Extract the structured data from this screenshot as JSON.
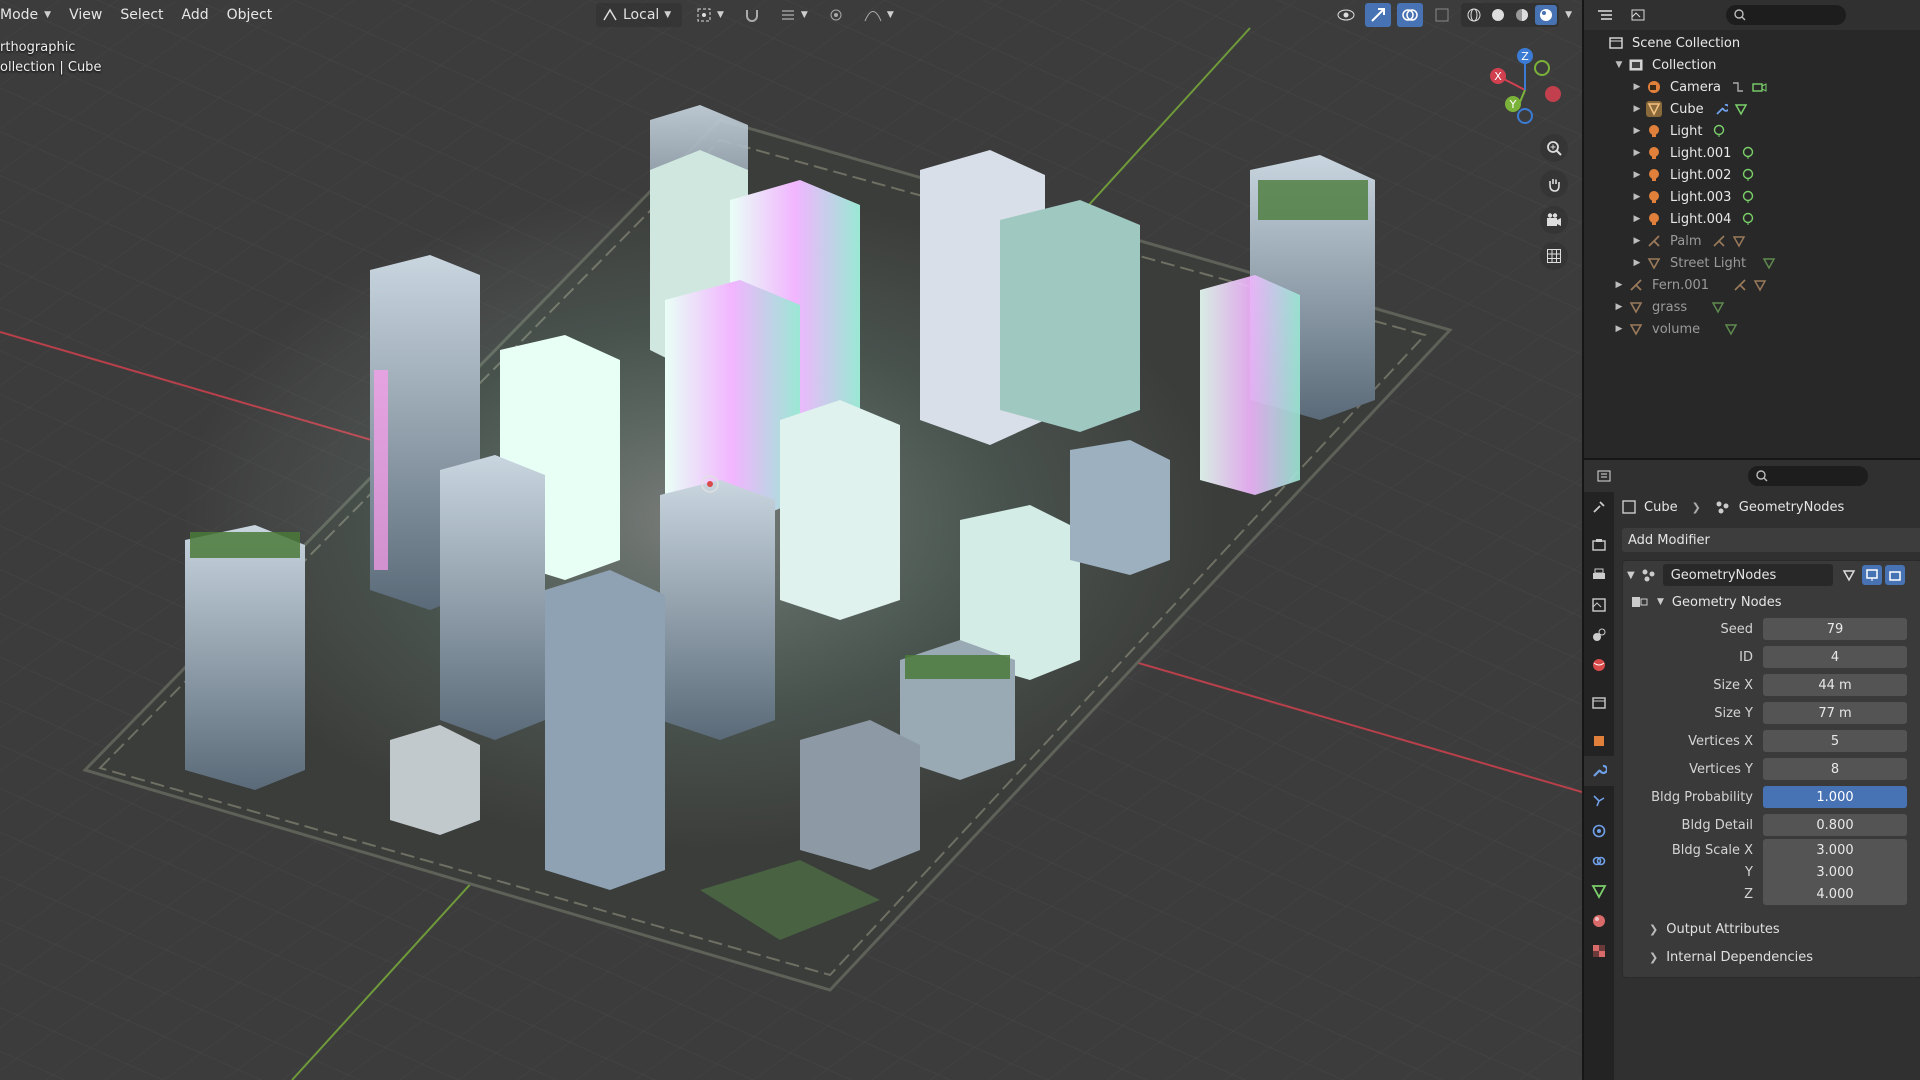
{
  "viewport": {
    "menu": {
      "mode": "Mode",
      "view": "View",
      "select": "Select",
      "add": "Add",
      "object": "Object"
    },
    "transform_orientation": "Local",
    "info_line1": "rthographic",
    "info_line2": "ollection | Cube",
    "gizmo_axes": {
      "x": "X",
      "y": "Y",
      "z": "Z"
    },
    "colors": {
      "x_axis": "#d0404f",
      "y_axis": "#7bb33a",
      "z_axis": "#3b7bd4",
      "accent": "#4772b3"
    }
  },
  "outliner": {
    "search_placeholder": "",
    "items": [
      {
        "label": "Scene Collection"
      },
      {
        "label": "Collection"
      },
      {
        "label": "Camera"
      },
      {
        "label": "Cube"
      },
      {
        "label": "Light"
      },
      {
        "label": "Light.001"
      },
      {
        "label": "Light.002"
      },
      {
        "label": "Light.003"
      },
      {
        "label": "Light.004"
      },
      {
        "label": "Palm"
      },
      {
        "label": "Street Light"
      },
      {
        "label": "Fern.001"
      },
      {
        "label": "grass"
      },
      {
        "label": "volume"
      }
    ]
  },
  "properties": {
    "search_placeholder": "",
    "breadcrumb": {
      "object": "Cube",
      "modifier": "GeometryNodes"
    },
    "add_modifier": "Add Modifier",
    "modifier_name": "GeometryNodes",
    "node_group": "Geometry Nodes",
    "fields": [
      {
        "label": "Seed",
        "value": "79"
      },
      {
        "label": "ID",
        "value": "4"
      },
      {
        "label": "Size X",
        "value": "44 m"
      },
      {
        "label": "Size Y",
        "value": "77 m"
      },
      {
        "label": "Vertices X",
        "value": "5"
      },
      {
        "label": "Vertices Y",
        "value": "8"
      },
      {
        "label": "Bldg Probability",
        "value": "1.000"
      },
      {
        "label": "Bldg Detail",
        "value": "0.800"
      },
      {
        "label": "Bldg Scale X",
        "value": "3.000"
      },
      {
        "label": "Y",
        "value": "3.000"
      },
      {
        "label": "Z",
        "value": "4.000"
      }
    ],
    "subpanels": {
      "output_attributes": "Output Attributes",
      "internal_dependencies": "Internal Dependencies"
    }
  }
}
